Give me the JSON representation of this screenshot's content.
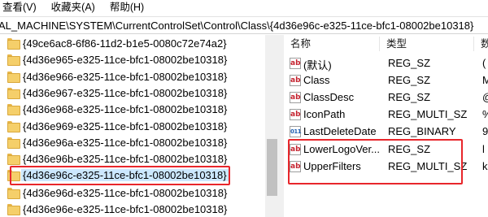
{
  "menubar": {
    "items": [
      "查看(V)",
      "收藏夹(A)",
      "帮助(H)"
    ]
  },
  "address": {
    "path": "AL_MACHINE\\SYSTEM\\CurrentControlSet\\Control\\Class\\{4d36e96c-e325-11ce-bfc1-08002be10318}"
  },
  "tree": {
    "items": [
      "{49ce6ac8-6f86-11d2-b1e5-0080c72e74a2}",
      "{4d36e965-e325-11ce-bfc1-08002be10318}",
      "{4d36e966-e325-11ce-bfc1-08002be10318}",
      "{4d36e967-e325-11ce-bfc1-08002be10318}",
      "{4d36e968-e325-11ce-bfc1-08002be10318}",
      "{4d36e969-e325-11ce-bfc1-08002be10318}",
      "{4d36e96a-e325-11ce-bfc1-08002be10318}",
      "{4d36e96b-e325-11ce-bfc1-08002be10318}",
      "{4d36e96c-e325-11ce-bfc1-08002be10318}",
      "{4d36e96d-e325-11ce-bfc1-08002be10318}",
      "{4d36e96e-e325-11ce-bfc1-08002be10318}"
    ],
    "selected_label": "{4d36e96c-e325-11ce-bfc1-08002be10318}"
  },
  "values": {
    "columns": {
      "name": "名称",
      "type": "类型",
      "data": "数"
    },
    "rows": [
      {
        "name": "(默认)",
        "type": "REG_SZ",
        "data": "(",
        "icon": "string-value-icon"
      },
      {
        "name": "Class",
        "type": "REG_SZ",
        "data": "M",
        "icon": "string-value-icon"
      },
      {
        "name": "ClassDesc",
        "type": "REG_SZ",
        "data": "@",
        "icon": "string-value-icon"
      },
      {
        "name": "IconPath",
        "type": "REG_MULTI_SZ",
        "data": "%",
        "icon": "string-value-icon"
      },
      {
        "name": "LastDeleteDate",
        "type": "REG_BINARY",
        "data": "9",
        "icon": "binary-value-icon"
      },
      {
        "name": "LowerLogoVer...",
        "type": "REG_SZ",
        "data": "l",
        "icon": "string-value-icon"
      },
      {
        "name": "UpperFilters",
        "type": "REG_MULTI_SZ",
        "data": "k",
        "icon": "string-value-icon"
      }
    ]
  },
  "colors": {
    "highlight_border": "#e8262b",
    "selection_fill": "#cce8ff",
    "folder": "#f5cf6a"
  }
}
